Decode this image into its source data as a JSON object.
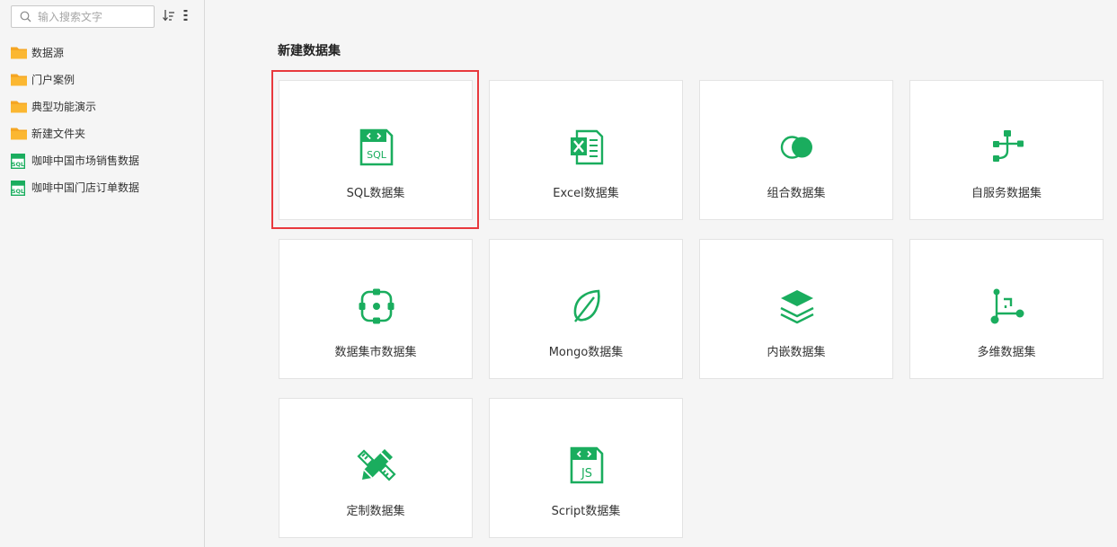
{
  "sidebar": {
    "search": {
      "placeholder": "输入搜索文字",
      "value": ""
    },
    "items": [
      {
        "label": "数据源",
        "icon": "folder-icon"
      },
      {
        "label": "门户案例",
        "icon": "folder-icon"
      },
      {
        "label": "典型功能演示",
        "icon": "folder-icon"
      },
      {
        "label": "新建文件夹",
        "icon": "folder-icon"
      },
      {
        "label": "咖啡中国市场销售数据",
        "icon": "sql-file-icon"
      },
      {
        "label": "咖啡中国门店订单数据",
        "icon": "sql-file-icon"
      }
    ]
  },
  "main": {
    "title": "新建数据集",
    "cards": [
      {
        "label": "SQL数据集",
        "icon": "sql-dataset-icon"
      },
      {
        "label": "Excel数据集",
        "icon": "excel-dataset-icon"
      },
      {
        "label": "组合数据集",
        "icon": "combined-dataset-icon"
      },
      {
        "label": "自服务数据集",
        "icon": "self-service-dataset-icon"
      },
      {
        "label": "数据集市数据集",
        "icon": "data-mart-dataset-icon"
      },
      {
        "label": "Mongo数据集",
        "icon": "mongo-dataset-icon"
      },
      {
        "label": "内嵌数据集",
        "icon": "embedded-dataset-icon"
      },
      {
        "label": "多维数据集",
        "icon": "multidimensional-dataset-icon"
      },
      {
        "label": "定制数据集",
        "icon": "custom-dataset-icon"
      },
      {
        "label": "Script数据集",
        "icon": "script-dataset-icon"
      }
    ]
  },
  "colors": {
    "accent": "#1aad5e",
    "folder": "#f5a623",
    "highlight": "#e8393d"
  }
}
